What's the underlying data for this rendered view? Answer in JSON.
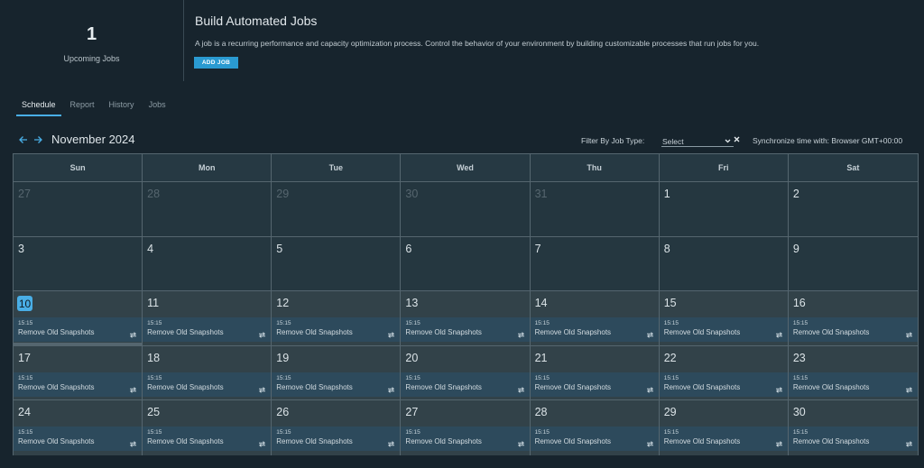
{
  "summary": {
    "count": "1",
    "label": "Upcoming Jobs"
  },
  "intro": {
    "title": "Build Automated Jobs",
    "description": "A job is a recurring performance and capacity optimization process. Control the behavior of your environment by building customizable processes that run jobs for you.",
    "add_button": "ADD JOB"
  },
  "tabs": [
    {
      "label": "Schedule",
      "active": true
    },
    {
      "label": "Report",
      "active": false
    },
    {
      "label": "History",
      "active": false
    },
    {
      "label": "Jobs",
      "active": false
    }
  ],
  "toolbar": {
    "prev_icon": "arrow-left-icon",
    "next_icon": "arrow-right-icon",
    "month": "November 2024",
    "filter_label": "Filter By Job Type:",
    "filter_value": "Select",
    "clear_icon": "close-icon",
    "sync": "Synchronize time with: Browser GMT+00:00"
  },
  "colors": {
    "accent": "#49aee6",
    "button": "#2a9ad1",
    "job_bg": "#2d4a5c"
  },
  "calendar": {
    "weekdays": [
      "Sun",
      "Mon",
      "Tue",
      "Wed",
      "Thu",
      "Fri",
      "Sat"
    ],
    "job": {
      "time": "15:15",
      "name": "Remove Old Snapshots",
      "icon": "recurring-icon"
    },
    "weeks": [
      [
        {
          "day": "27",
          "other": true
        },
        {
          "day": "28",
          "other": true
        },
        {
          "day": "29",
          "other": true
        },
        {
          "day": "30",
          "other": true
        },
        {
          "day": "31",
          "other": true
        },
        {
          "day": "1"
        },
        {
          "day": "2"
        }
      ],
      [
        {
          "day": "3"
        },
        {
          "day": "4"
        },
        {
          "day": "5"
        },
        {
          "day": "6"
        },
        {
          "day": "7"
        },
        {
          "day": "8"
        },
        {
          "day": "9"
        }
      ],
      [
        {
          "day": "10",
          "today": true,
          "job": true
        },
        {
          "day": "11",
          "job": true
        },
        {
          "day": "12",
          "job": true
        },
        {
          "day": "13",
          "job": true
        },
        {
          "day": "14",
          "job": true
        },
        {
          "day": "15",
          "job": true
        },
        {
          "day": "16",
          "job": true
        }
      ],
      [
        {
          "day": "17",
          "job": true
        },
        {
          "day": "18",
          "job": true
        },
        {
          "day": "19",
          "job": true
        },
        {
          "day": "20",
          "job": true
        },
        {
          "day": "21",
          "job": true
        },
        {
          "day": "22",
          "job": true
        },
        {
          "day": "23",
          "job": true
        }
      ],
      [
        {
          "day": "24",
          "job": true
        },
        {
          "day": "25",
          "job": true
        },
        {
          "day": "26",
          "job": true
        },
        {
          "day": "27",
          "job": true
        },
        {
          "day": "28",
          "job": true
        },
        {
          "day": "29",
          "job": true
        },
        {
          "day": "30",
          "job": true
        }
      ]
    ]
  }
}
